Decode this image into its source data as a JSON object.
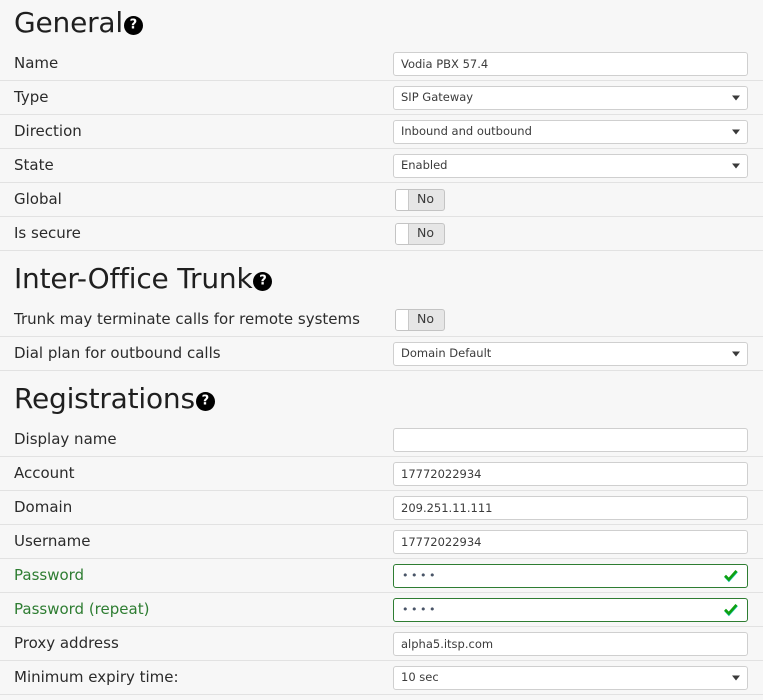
{
  "help_icon_glyph": "?",
  "colors": {
    "page_background": "#f7f7f7",
    "input_border": "#cfcfcf",
    "valid_border": "#2e7d32",
    "valid_label": "#2e7d32",
    "rule": "#e2e2e2",
    "toggle_body": "#e6e6e6",
    "check_mark": "#10a010",
    "check_mark_highlight": "#16c8b4",
    "label_text": "#2b2b2b"
  },
  "sections": [
    {
      "id": "general",
      "title": "General",
      "help_icon": "help-circle-icon",
      "rows": [
        {
          "id": "name",
          "label": "Name",
          "control": "text",
          "value": "Vodia PBX 57.4",
          "placeholder": ""
        },
        {
          "id": "type",
          "label": "Type",
          "control": "select",
          "value": "SIP Gateway"
        },
        {
          "id": "direction",
          "label": "Direction",
          "control": "select",
          "value": "Inbound and outbound"
        },
        {
          "id": "state",
          "label": "State",
          "control": "select",
          "value": "Enabled"
        },
        {
          "id": "global",
          "label": "Global",
          "control": "toggle",
          "value": "No"
        },
        {
          "id": "is-secure",
          "label": "Is secure",
          "control": "toggle",
          "value": "No"
        }
      ]
    },
    {
      "id": "inter-office-trunk",
      "title": "Inter-Office Trunk",
      "help_icon": "help-circle-icon",
      "rows": [
        {
          "id": "trunk-may-terminate-calls",
          "label": "Trunk may terminate calls for remote systems",
          "control": "toggle",
          "value": "No"
        },
        {
          "id": "dial-plan-for-outbound-calls",
          "label": "Dial plan for outbound calls",
          "control": "select",
          "value": "Domain Default"
        }
      ]
    },
    {
      "id": "registrations",
      "title": "Registrations",
      "help_icon": "help-circle-icon",
      "rows": [
        {
          "id": "display-name",
          "label": "Display name",
          "control": "text",
          "value": "",
          "placeholder": ""
        },
        {
          "id": "account",
          "label": "Account",
          "control": "text",
          "value": "17772022934",
          "placeholder": ""
        },
        {
          "id": "domain",
          "label": "Domain",
          "control": "text",
          "value": "209.251.11.111",
          "placeholder": ""
        },
        {
          "id": "username",
          "label": "Username",
          "control": "text",
          "value": "17772022934",
          "placeholder": ""
        },
        {
          "id": "password",
          "label": "Password",
          "control": "password",
          "value": "••••",
          "label_state": "valid",
          "valid": true
        },
        {
          "id": "password-repeat",
          "label": "Password (repeat)",
          "control": "password",
          "value": "••••",
          "label_state": "valid",
          "valid": true
        },
        {
          "id": "proxy-address",
          "label": "Proxy address",
          "control": "text",
          "value": "alpha5.itsp.com",
          "placeholder": ""
        },
        {
          "id": "minimum-expiry-time",
          "label": "Minimum expiry time:",
          "control": "select",
          "value": "10 sec"
        }
      ]
    }
  ]
}
